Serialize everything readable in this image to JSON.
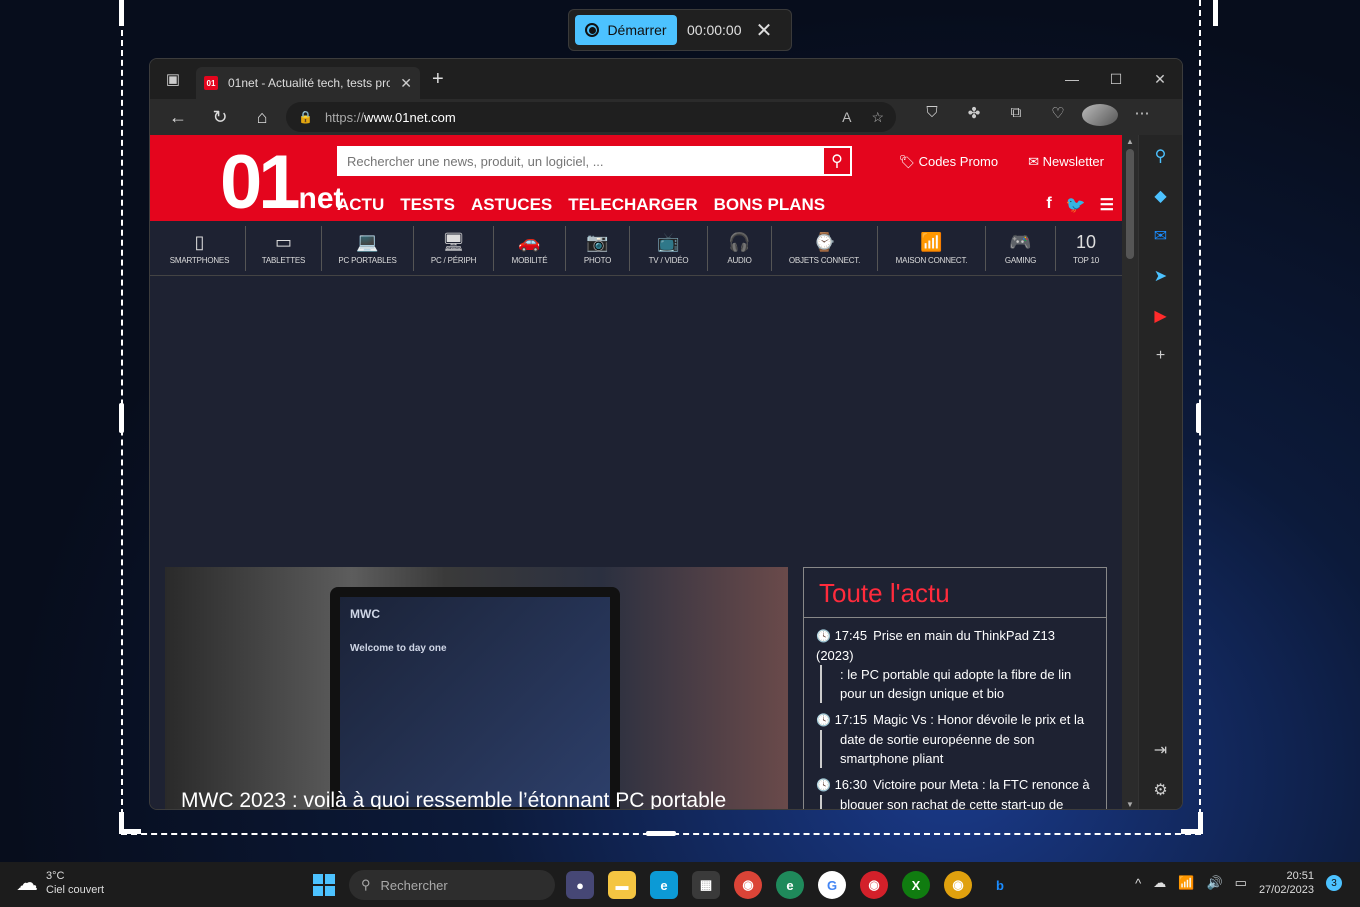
{
  "recorder": {
    "start_label": "Démarrer",
    "time": "00:00:00"
  },
  "browser": {
    "tab_title": "01net - Actualité tech, tests prod",
    "favicon_text": "01",
    "url_prefix": "https://",
    "url_host": "www.01net.com"
  },
  "site": {
    "logo_big": "01",
    "logo_small": "net",
    "search_placeholder": "Rechercher une news, produit, un logiciel, ...",
    "codes_promo": "Codes Promo",
    "newsletter": "Newsletter",
    "nav": [
      "ACTU",
      "TESTS",
      "ASTUCES",
      "TELECHARGER",
      "BONS PLANS"
    ],
    "categories": [
      {
        "icon": "▯",
        "label": "SMARTPHONES",
        "w": 92
      },
      {
        "icon": "▭",
        "label": "TABLETTES",
        "w": 76
      },
      {
        "icon": "💻",
        "label": "PC PORTABLES",
        "w": 92
      },
      {
        "icon": "🖥",
        "label": "PC / PÉRIPH",
        "w": 80
      },
      {
        "icon": "🚗",
        "label": "MOBILITÉ",
        "w": 72
      },
      {
        "icon": "📷",
        "label": "PHOTO",
        "w": 64
      },
      {
        "icon": "📺",
        "label": "TV / VIDÉO",
        "w": 78
      },
      {
        "icon": "🎧",
        "label": "AUDIO",
        "w": 64
      },
      {
        "icon": "⌚",
        "label": "OBJETS CONNECT.",
        "w": 106
      },
      {
        "icon": "📶",
        "label": "MAISON CONNECT.",
        "w": 108
      },
      {
        "icon": "🎮",
        "label": "GAMING",
        "w": 70
      },
      {
        "icon": "10",
        "label": "TOP 10",
        "w": 60
      }
    ],
    "hero_title": "MWC 2023 : voilà à quoi ressemble l’étonnant PC portable",
    "hero_screen_brand": "MWC",
    "hero_screen_welcome": "Welcome to day one",
    "news_heading": "Toute l'actu",
    "news": [
      {
        "time": "17:45",
        "text": "Prise en main du ThinkPad Z13 (2023)",
        "cont": ": le PC portable qui adopte la fibre de lin pour un design unique et bio"
      },
      {
        "time": "17:15",
        "text": "Magic Vs : Honor dévoile le prix et la",
        "cont": "date de sortie européenne de son smartphone pliant"
      },
      {
        "time": "16:30",
        "text": "Victoire pour Meta : la FTC renonce à",
        "cont": "bloquer son rachat de cette start-up de réalité virtuelle"
      }
    ]
  },
  "taskbar": {
    "temp": "3°C",
    "weather": "Ciel couvert",
    "search": "Rechercher",
    "time": "20:51",
    "date": "27/02/2023",
    "notif_count": "3"
  }
}
